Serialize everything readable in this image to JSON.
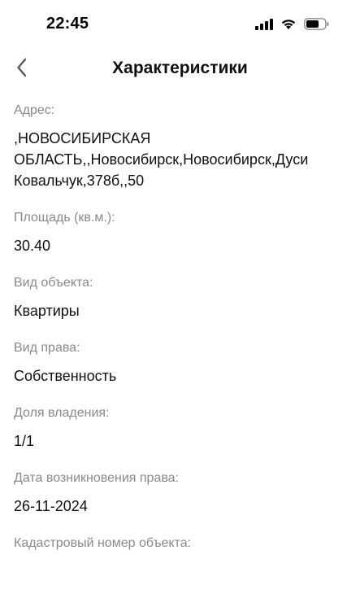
{
  "status_bar": {
    "time": "22:45",
    "icons": [
      "signal-icon",
      "wifi-icon",
      "battery-icon"
    ]
  },
  "header": {
    "title": "Характеристики",
    "back_icon": "chevron-left-icon"
  },
  "fields": [
    {
      "label": "Адрес:",
      "value": ",НОВОСИБИРСКАЯ ОБЛАСТЬ,,Новосибирск,Новосибирск,Дуси Ковальчук,378б,,50"
    },
    {
      "label": "Площадь (кв.м.):",
      "value": "30.40"
    },
    {
      "label": "Вид объекта:",
      "value": "Квартиры"
    },
    {
      "label": "Вид права:",
      "value": "Собственность"
    },
    {
      "label": "Доля владения:",
      "value": "1/1"
    },
    {
      "label": "Дата возникновения права:",
      "value": "26-11-2024"
    },
    {
      "label": "Кадастровый номер объекта:",
      "value": ""
    }
  ],
  "colors": {
    "label": "#8a8a8e",
    "value": "#111111",
    "background": "#ffffff"
  }
}
